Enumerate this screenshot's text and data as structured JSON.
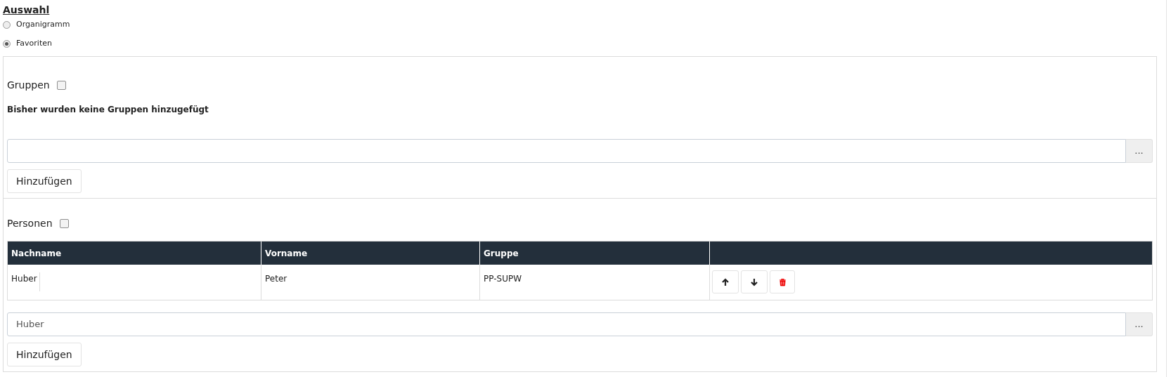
{
  "title": "Auswahl",
  "options": [
    {
      "label": "Organigramm",
      "selected": false
    },
    {
      "label": "Favoriten",
      "selected": true
    }
  ],
  "groups": {
    "label": "Gruppen",
    "checked": false,
    "empty_message": "Bisher wurden keine Gruppen hinzugefügt",
    "field": {
      "browse": "..."
    },
    "add_button": "Hinzufügen"
  },
  "persons": {
    "label": "Personen",
    "checked": false,
    "table": {
      "columns": [
        "Nachname",
        "Vorname",
        "Gruppe"
      ],
      "rows": [
        {
          "cells": [
            "Huber",
            "Peter",
            "PP-SUPW"
          ]
        }
      ]
    },
    "field": {
      "value": "Huber",
      "browse": "..."
    },
    "add_button": "Hinzufügen"
  }
}
